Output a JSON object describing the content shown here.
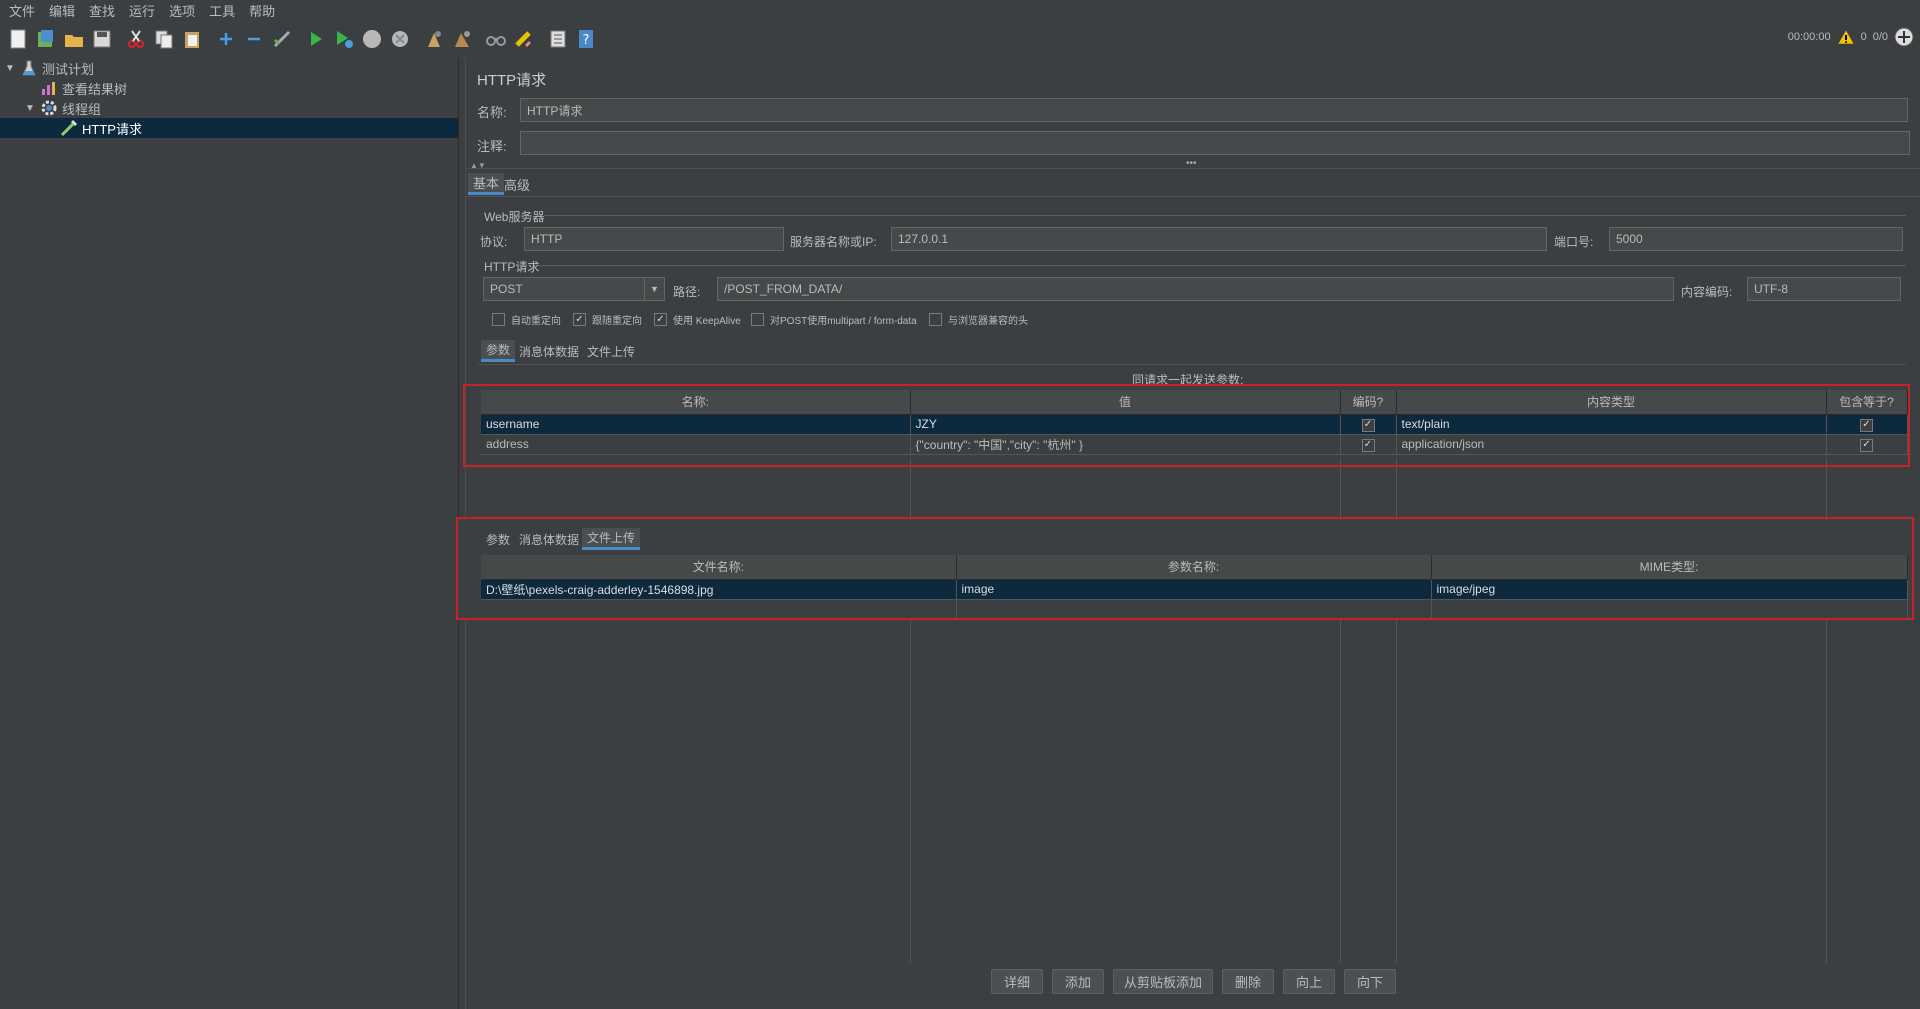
{
  "menu": [
    "文件",
    "编辑",
    "查找",
    "运行",
    "选项",
    "工具",
    "帮助"
  ],
  "status": {
    "time": "00:00:00",
    "warnings": "0",
    "threads": "0/0"
  },
  "tree": [
    {
      "label": "测试计划",
      "icon": "flask-icon"
    },
    {
      "label": "查看结果树",
      "icon": "chart-icon"
    },
    {
      "label": "线程组",
      "icon": "gear-icon"
    },
    {
      "label": "HTTP请求",
      "icon": "pipette-icon"
    }
  ],
  "panel": {
    "title": "HTTP请求",
    "name_label": "名称:",
    "name_value": "HTTP请求",
    "comment_label": "注释:",
    "comment_value": "",
    "tabs": [
      "基本",
      "高级"
    ],
    "web_server": {
      "legend": "Web服务器",
      "protocol_label": "协议:",
      "protocol": "HTTP",
      "server_label": "服务器名称或IP:",
      "server": "127.0.0.1",
      "port_label": "端口号:",
      "port": "5000"
    },
    "http": {
      "legend": "HTTP请求",
      "method": "POST",
      "path_label": "路径:",
      "path": "/POST_FROM_DATA/",
      "encoding_label": "内容编码:",
      "encoding": "UTF-8"
    },
    "options": [
      {
        "label": "自动重定向",
        "checked": false
      },
      {
        "label": "跟随重定向",
        "checked": true
      },
      {
        "label": "使用 KeepAlive",
        "checked": true
      },
      {
        "label": "对POST使用multipart / form-data",
        "checked": false
      },
      {
        "label": "与浏览器兼容的头",
        "checked": false
      }
    ],
    "subtabs": [
      "参数",
      "消息体数据",
      "文件上传"
    ],
    "params_caption": "同请求一起发送参数:",
    "params_headers": [
      "名称:",
      "值",
      "编码?",
      "内容类型",
      "包含等于?"
    ],
    "params_rows": [
      {
        "name": "username",
        "value": "JZY",
        "encode": true,
        "ctype": "text/plain",
        "equals": true
      },
      {
        "name": "address",
        "value": "{\"country\": \"中国\",\"city\": \"杭州\" }",
        "encode": true,
        "ctype": "application/json",
        "equals": true
      }
    ],
    "files_headers": [
      "文件名称:",
      "参数名称:",
      "MIME类型:"
    ],
    "files_rows": [
      {
        "file": "D:\\壁纸\\pexels-craig-adderley-1546898.jpg",
        "param": "image",
        "mime": "image/jpeg"
      }
    ],
    "buttons": [
      "详细",
      "添加",
      "从剪贴板添加",
      "删除",
      "向上",
      "向下"
    ]
  }
}
